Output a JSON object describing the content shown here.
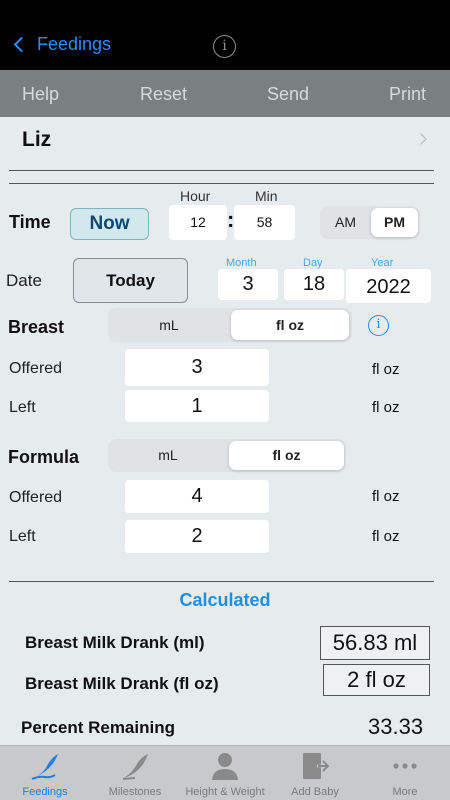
{
  "nav": {
    "back_label": "Feedings"
  },
  "toolbar": {
    "help": "Help",
    "reset": "Reset",
    "send": "Send",
    "print": "Print"
  },
  "baby": {
    "name": "Liz"
  },
  "time": {
    "label": "Time",
    "now_label": "Now",
    "hour_label": "Hour",
    "min_label": "Min",
    "hour": "12",
    "separator": ":",
    "minute": "58",
    "am": "AM",
    "pm": "PM",
    "selected": "PM"
  },
  "date": {
    "label": "Date",
    "today_label": "Today",
    "month_label": "Month",
    "day_label": "Day",
    "year_label": "Year",
    "month": "3",
    "day": "18",
    "year": "2022"
  },
  "breast": {
    "label": "Breast",
    "unit_ml": "mL",
    "unit_floz": "fl oz",
    "selected_unit": "fl oz",
    "offered_label": "Offered",
    "offered": "3",
    "offered_unit": "fl oz",
    "left_label": "Left",
    "left": "1",
    "left_unit": "fl oz"
  },
  "formula": {
    "label": "Formula",
    "unit_ml": "mL",
    "unit_floz": "fl oz",
    "selected_unit": "fl oz",
    "offered_label": "Offered",
    "offered": "4",
    "offered_unit": "fl oz",
    "left_label": "Left",
    "left": "2",
    "left_unit": "fl oz"
  },
  "calculated": {
    "title": "Calculated",
    "breast_ml_label": "Breast Milk Drank (ml)",
    "breast_ml_value": "56.83 ml",
    "breast_floz_label": "Breast Milk Drank (fl oz)",
    "breast_floz_value": "2 fl oz",
    "percent_label": "Percent Remaining",
    "percent_value": "33.33"
  },
  "tabs": [
    {
      "label": "Feedings",
      "icon": "feather-pen-icon",
      "active": true
    },
    {
      "label": "Milestones",
      "icon": "quill-icon",
      "active": false
    },
    {
      "label": "Height & Weight",
      "icon": "person-icon",
      "active": false
    },
    {
      "label": "Add Baby",
      "icon": "add-document-icon",
      "active": false
    },
    {
      "label": "More",
      "icon": "more-dots-icon",
      "active": false
    }
  ],
  "colors": {
    "accent": "#2a8cff",
    "calculated_title": "#1f8fe6",
    "navbar": "#000000",
    "toolbar": "#7a7f82",
    "background": "#e6ecee"
  }
}
